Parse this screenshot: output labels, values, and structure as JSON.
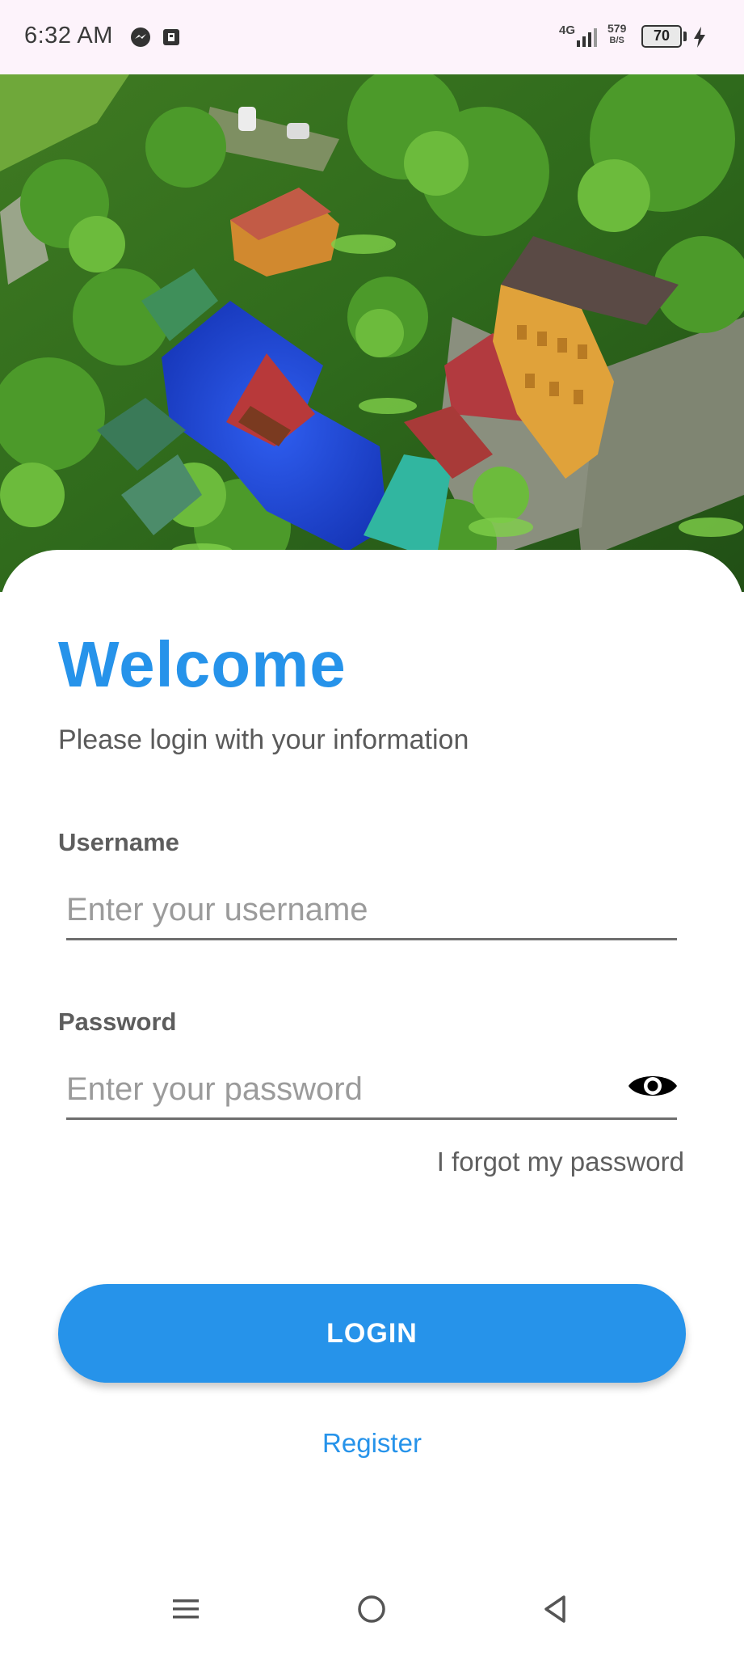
{
  "status_bar": {
    "time": "6:32 AM",
    "network": "4G",
    "speed_value": "579",
    "speed_unit": "B/S",
    "battery": "70"
  },
  "hero": {
    "icon": "resort-aerial-photo"
  },
  "login": {
    "title": "Welcome",
    "subtitle": "Please login with your information",
    "username_label": "Username",
    "username_placeholder": "Enter your username",
    "password_label": "Password",
    "password_placeholder": "Enter your password",
    "forgot_link": "I forgot my password",
    "login_button": "LOGIN",
    "register_link": "Register"
  },
  "colors": {
    "accent": "#2693ea",
    "status_bar_bg": "#fdf3fb"
  },
  "nav": {
    "menu_icon": "menu-icon",
    "home_icon": "home-circle-icon",
    "back_icon": "back-triangle-icon"
  }
}
